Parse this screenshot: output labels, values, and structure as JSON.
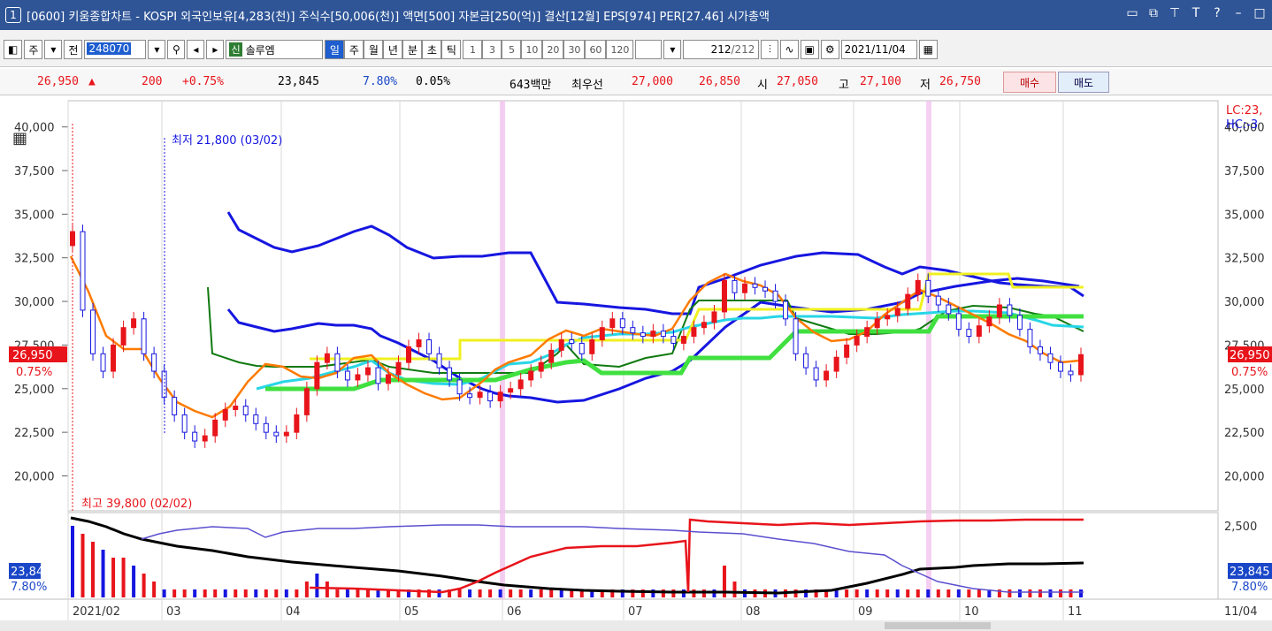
{
  "titlebar": {
    "window_number": "1",
    "title": "[0600] 키움종합차트 - KOSPI 외국인보유[4,283(천)] 주식수[50,006(천)] 액면[500] 자본금[250(억)] 결산[12월] EPS[974] PER[27.46] 시가총액"
  },
  "toolbar": {
    "period_type": "주",
    "compare": "전",
    "stock_code": "248070",
    "stock_badge": "신",
    "stock_name": "솔루엠",
    "period_buttons": [
      "일",
      "주",
      "월",
      "년",
      "분",
      "초",
      "틱"
    ],
    "intervals": [
      "1",
      "3",
      "5",
      "10",
      "20",
      "30",
      "60",
      "120"
    ],
    "count": "212",
    "count_total": "/212",
    "date": "2021/11/04"
  },
  "quote": {
    "price": "26,950",
    "change": "200",
    "change_rate": "+0.75%",
    "volume": "23,845",
    "turnover": "7.80%",
    "ratio": "0.05%",
    "amount": "643백만",
    "best_label": "최우선",
    "ask": "27,000",
    "bid": "26,850",
    "open_label": "시",
    "open": "27,050",
    "high_label": "고",
    "high": "27,100",
    "low_label": "저",
    "low": "26,750",
    "buy_label": "매수",
    "sell_label": "매도"
  },
  "chart_data": {
    "type": "line",
    "title": "",
    "yaxis_ticks": [
      "40,000",
      "37,500",
      "35,000",
      "32,500",
      "30,000",
      "27,500",
      "25,000",
      "22,500",
      "20,000"
    ],
    "ylim": [
      18000,
      41500
    ],
    "x_labels": [
      "2021/02",
      "03",
      "04",
      "05",
      "06",
      "07",
      "08",
      "09",
      "10",
      "11"
    ],
    "right_x_label": "11/04",
    "current_price_label": "26,950",
    "current_rate_label": "0.75%",
    "annotations": {
      "low_text": "최저 21,800 (03/02)",
      "high_text": "최고 39,800 (02/02)",
      "lc_text": "LC:23,",
      "hc_text": "HC:-3"
    },
    "price_close": [
      34000,
      29500,
      27000,
      26000,
      27500,
      28500,
      29000,
      27000,
      26000,
      24500,
      23500,
      22500,
      22000,
      22300,
      23200,
      23800,
      24000,
      23500,
      23000,
      22500,
      22300,
      22500,
      23500,
      25000,
      26500,
      27000,
      26000,
      25500,
      25800,
      26200,
      25300,
      25800,
      26500,
      27400,
      27800,
      27000,
      26200,
      25500,
      24700,
      24500,
      24800,
      24300,
      24800,
      25000,
      25500,
      26000,
      26500,
      27200,
      27800,
      27600,
      27000,
      27800,
      28500,
      29000,
      28500,
      28200,
      28000,
      28300,
      28000,
      27600,
      28000,
      28500,
      28800,
      29400,
      31200,
      30500,
      31000,
      30800,
      30600,
      30000,
      29000,
      27000,
      26200,
      25500,
      26000,
      26800,
      27500,
      28000,
      28500,
      29000,
      29200,
      29600,
      30400,
      31200,
      30300,
      29800,
      29300,
      28400,
      28000,
      28600,
      29100,
      29800,
      29200,
      28400,
      27400,
      27000,
      26500,
      26000,
      25800,
      26950
    ],
    "volume_series": {
      "name": "",
      "values": [
        9,
        8,
        7,
        6,
        5,
        5,
        4,
        3,
        2,
        1,
        1,
        1,
        1,
        1,
        1,
        1,
        1,
        1,
        1,
        1,
        1,
        1,
        1,
        2,
        3,
        2,
        1,
        1,
        1,
        1,
        1,
        1,
        1,
        1,
        1,
        1,
        1,
        1,
        1,
        1,
        1,
        1,
        1,
        1,
        1,
        1,
        1,
        1,
        1,
        1,
        1,
        1,
        1,
        1,
        1,
        1,
        1,
        1,
        1,
        1,
        1,
        1,
        1,
        1,
        4,
        2,
        1,
        1,
        1,
        1,
        1,
        1,
        1,
        1,
        1,
        1,
        1,
        1,
        1,
        1,
        1,
        1,
        1,
        1,
        1,
        1,
        1,
        1,
        1,
        1,
        1,
        1,
        1,
        1,
        1,
        1,
        1,
        1,
        1,
        1
      ]
    },
    "lower_panel": {
      "ytick": "2,500",
      "volume_label": "23,845",
      "rate_label": "7.80%"
    }
  }
}
